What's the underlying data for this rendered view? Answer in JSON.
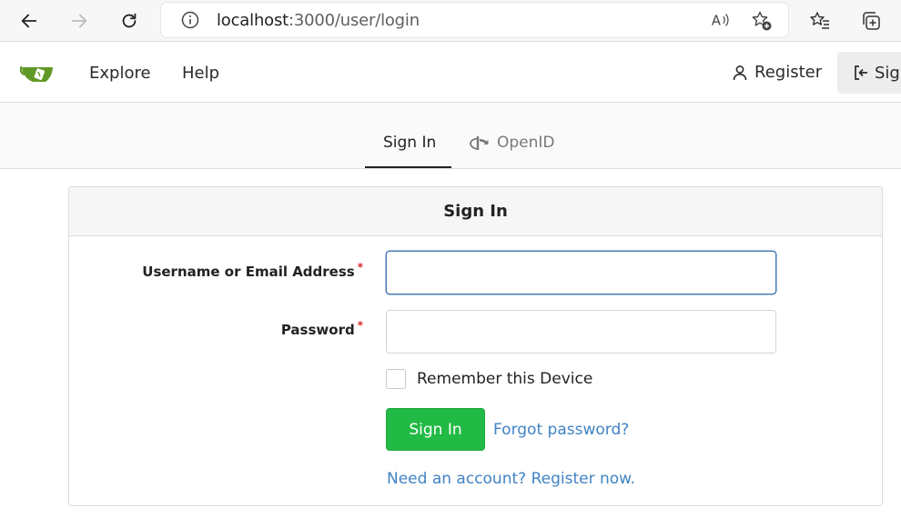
{
  "browser": {
    "url_host": "localhost",
    "url_path": ":3000/user/login"
  },
  "navbar": {
    "explore_label": "Explore",
    "help_label": "Help",
    "register_label": "Register",
    "signin_label": "Sign"
  },
  "tabs": {
    "signin_label": "Sign In",
    "openid_label": "OpenID"
  },
  "form": {
    "title": "Sign In",
    "username_label": "Username or Email Address",
    "password_label": "Password",
    "required_mark": "*",
    "username_value": "",
    "password_value": "",
    "remember_label": "Remember this Device",
    "submit_label": "Sign In",
    "forgot_label": "Forgot password?",
    "register_link_label": "Need an account? Register now."
  },
  "colors": {
    "primary_button": "#21ba45",
    "link": "#4183c4",
    "required": "#db2828",
    "focus_border": "#4a7ab5"
  },
  "icons": {
    "back": "back-arrow-icon",
    "forward": "forward-arrow-icon",
    "refresh": "refresh-icon",
    "info": "info-icon",
    "read_aloud": "read-aloud-icon",
    "add_favorite": "add-favorite-icon",
    "favorites": "favorites-icon",
    "collections": "collections-icon",
    "user": "user-icon",
    "sign_in": "sign-in-icon",
    "openid": "openid-icon"
  }
}
